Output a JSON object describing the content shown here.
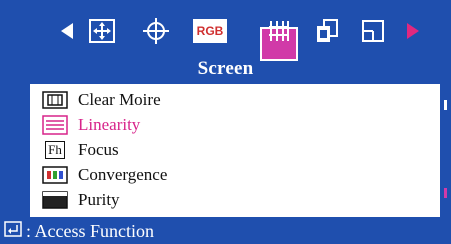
{
  "menu": {
    "title": "Screen",
    "icons": [
      "arrow-left-icon",
      "position-icon",
      "image-size-icon",
      "rgb-icon",
      "screen-icon",
      "osd-icon",
      "setup-icon",
      "arrow-right-icon"
    ],
    "rgb_label": "RGB",
    "selected_icon": "screen-icon"
  },
  "items": [
    {
      "label": "Clear Moire",
      "icon": "clear-moire-icon",
      "active": false
    },
    {
      "label": "Linearity",
      "icon": "linearity-icon",
      "active": true
    },
    {
      "label": "Focus",
      "icon": "focus-icon",
      "active": false
    },
    {
      "label": "Convergence",
      "icon": "convergence-icon",
      "active": false
    },
    {
      "label": "Purity",
      "icon": "purity-icon",
      "active": false
    }
  ],
  "focus_icon_text": "Fh",
  "footer": {
    "hint": ": Access Function"
  },
  "colors": {
    "background": "#1f4fae",
    "accent": "#d13aa8",
    "active_text": "#d7238a",
    "arrow_right": "#e0287f"
  }
}
